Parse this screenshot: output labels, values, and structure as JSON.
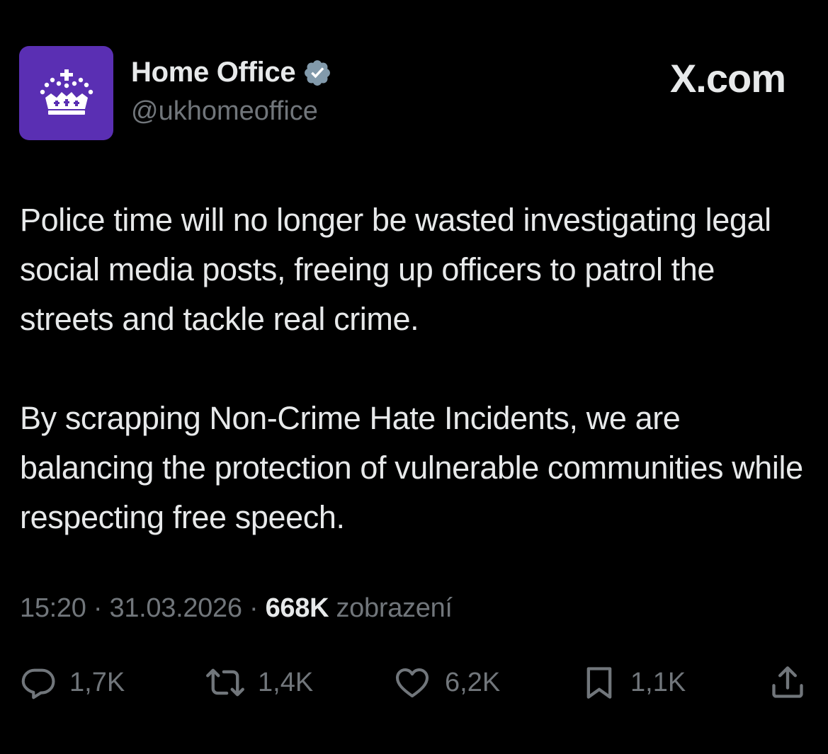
{
  "author": {
    "display_name": "Home Office",
    "handle": "@ukhomeoffice",
    "avatar_icon": "crown-icon",
    "avatar_color": "#5a2fb3",
    "verified_icon": "verified-badge-icon",
    "verified_color": "#829aab"
  },
  "brand": {
    "label": "X.com"
  },
  "tweet": {
    "paragraph_1": "Police time will no longer be wasted investigating legal social media posts, freeing up officers to patrol the streets and tackle real crime.",
    "paragraph_2": "By scrapping Non-Crime Hate Incidents, we are balancing the protection of vulnerable communities while respecting free speech."
  },
  "meta": {
    "time": "15:20",
    "separator": "·",
    "date": "31.03.2026",
    "views_count": "668K",
    "views_label": "zobrazení"
  },
  "actions": {
    "replies": {
      "icon": "reply-icon",
      "count": "1,7K"
    },
    "reposts": {
      "icon": "repost-icon",
      "count": "1,4K"
    },
    "likes": {
      "icon": "heart-icon",
      "count": "6,2K"
    },
    "bookmarks": {
      "icon": "bookmark-icon",
      "count": "1,1K"
    },
    "share": {
      "icon": "share-icon"
    }
  },
  "colors": {
    "background": "#000000",
    "primary_text": "#e7e9ea",
    "secondary_text": "#71767b"
  }
}
